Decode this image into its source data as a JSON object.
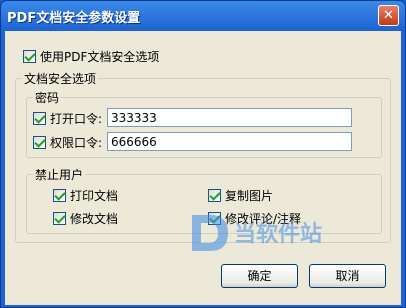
{
  "window": {
    "title": "PDF文档安全参数设置"
  },
  "use_security": {
    "label": "使用PDF文档安全选项",
    "checked": true
  },
  "security_options": {
    "title": "文档安全选项",
    "password": {
      "title": "密码",
      "open_password": {
        "label": "打开口令:",
        "value": "333333",
        "checked": true
      },
      "permission_password": {
        "label": "权限口令:",
        "value": "666666",
        "checked": true
      }
    },
    "restrictions": {
      "title": "禁止用户",
      "print": {
        "label": "打印文档",
        "checked": true
      },
      "copy_images": {
        "label": "复制图片",
        "checked": true
      },
      "modify": {
        "label": "修改文档",
        "checked": true
      },
      "modify_comments": {
        "label": "修改评论/注释",
        "checked": true
      }
    }
  },
  "buttons": {
    "ok": "确定",
    "cancel": "取消"
  },
  "watermark": {
    "text": "D 当软件站"
  }
}
